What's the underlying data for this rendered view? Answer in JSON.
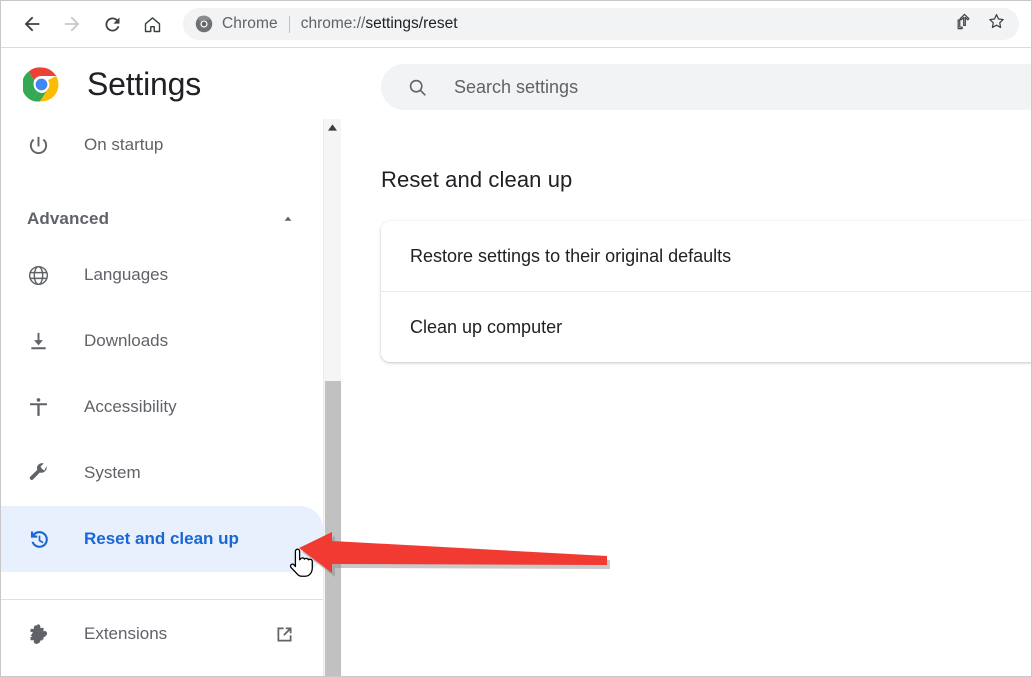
{
  "browser": {
    "nav": {
      "back_icon": "back-arrow-icon",
      "forward_icon": "forward-arrow-icon",
      "reload_icon": "reload-icon",
      "home_icon": "home-icon"
    },
    "omnibox": {
      "chrome_icon": "chrome-logo-icon",
      "brand": "Chrome",
      "url_prefix": "chrome://",
      "url_strong": "settings/reset",
      "full_url": "chrome://settings/reset"
    },
    "actions": {
      "share_icon": "share-icon",
      "bookmark_icon": "star-icon"
    }
  },
  "settings": {
    "logo_icon": "chrome-logo-icon",
    "title": "Settings"
  },
  "sidebar": {
    "items": [
      {
        "label": "On startup",
        "icon": "power-icon",
        "selected": false
      },
      {
        "label": "Advanced",
        "icon": "none",
        "section": true,
        "chevron": "chevron-up-icon"
      },
      {
        "label": "Languages",
        "icon": "globe-icon",
        "selected": false
      },
      {
        "label": "Downloads",
        "icon": "download-icon",
        "selected": false
      },
      {
        "label": "Accessibility",
        "icon": "accessibility-icon",
        "selected": false
      },
      {
        "label": "System",
        "icon": "wrench-icon",
        "selected": false
      },
      {
        "label": "Reset and clean up",
        "icon": "restore-history-icon",
        "selected": true
      },
      {
        "label": "Extensions",
        "icon": "puzzle-piece-icon",
        "selected": false,
        "external": "external-link-icon"
      }
    ],
    "accent_color": "#1967d2",
    "selected_background": "#e8f0fe"
  },
  "search": {
    "icon": "search-icon",
    "placeholder": "Search settings",
    "value": ""
  },
  "main": {
    "page_title": "Reset and clean up",
    "card_rows": [
      {
        "label": "Restore settings to their original defaults"
      },
      {
        "label": "Clean up computer"
      }
    ]
  },
  "annotation": {
    "arrow_color": "#f03a32",
    "arrow_direction": "left",
    "cursor": "pointing-hand-cursor"
  }
}
